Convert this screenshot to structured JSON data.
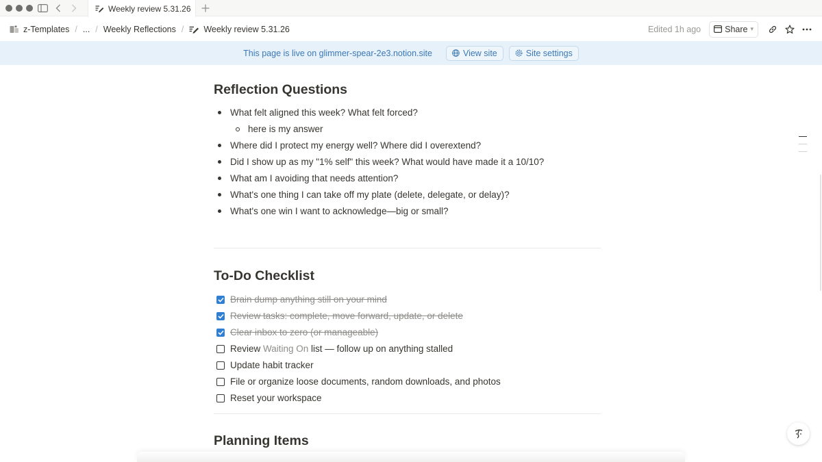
{
  "tab": {
    "title": "Weekly review 5.31.26"
  },
  "breadcrumb": {
    "items": [
      "z-Templates",
      "...",
      "Weekly Reflections",
      "Weekly review 5.31.26"
    ]
  },
  "topbar": {
    "edited": "Edited 1h ago",
    "share_label": "Share"
  },
  "banner": {
    "text": "This page is live on glimmer-spear-2e3.notion.site",
    "view_site": "View site",
    "site_settings": "Site settings"
  },
  "reflection": {
    "heading": "Reflection Questions",
    "items": [
      "What felt aligned this week? What felt forced?",
      "here is my answer",
      "Where did I protect my energy well? Where did I overextend?",
      "Did I show up as my \"1% self\" this week? What would have made it a 10/10?",
      "What am I avoiding that needs attention?",
      "What's one thing I can take off my plate (delete, delegate, or delay)?",
      "What's one win I want to acknowledge—big or small?"
    ]
  },
  "todo": {
    "heading": "To-Do Checklist",
    "items": [
      {
        "text": "Brain dump anything still on your mind",
        "checked": true
      },
      {
        "text": "Review tasks: complete, move forward, update, or delete",
        "checked": true
      },
      {
        "text": "Clear inbox to zero (or manageable)",
        "checked": true
      },
      {
        "prefix": "Review ",
        "mention": "Waiting On",
        "suffix": " list — follow up on anything stalled",
        "checked": false
      },
      {
        "text": "Update habit tracker",
        "checked": false
      },
      {
        "text": "File or organize loose documents, random downloads, and photos",
        "checked": false
      },
      {
        "text": "Reset your workspace",
        "checked": false
      }
    ]
  },
  "planning": {
    "heading": "Planning Items"
  },
  "colors": {
    "accent": "#2f7fd3",
    "banner_bg": "#e7f1fa",
    "banner_text": "#3b78b6",
    "text": "#37352f"
  },
  "icons": [
    "sidebar-toggle-icon",
    "back-arrow-icon",
    "forward-arrow-icon",
    "new-tab-icon",
    "page-edit-icon",
    "lock-icon",
    "link-icon",
    "star-icon",
    "more-icon",
    "globe-icon",
    "gear-icon",
    "checkmark-icon"
  ]
}
